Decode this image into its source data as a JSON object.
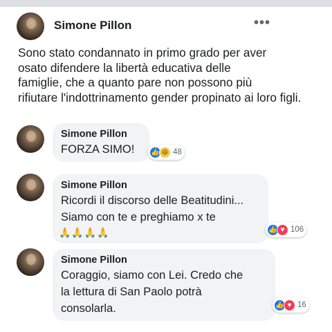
{
  "post": {
    "author": "Simone Pillon",
    "more_glyph": "•••",
    "text_lines": [
      "Sono stato condannato in primo grado per aver",
      "osato difendere la libertà educativa delle",
      "famiglie, che a quanto pare non possono più",
      "rifiutare l'indottrinamento gender propinato ai loro figli."
    ]
  },
  "comments": [
    {
      "author": "Simone Pillon",
      "lines": [
        "FORZA SIMO!"
      ],
      "reactions": [
        "like",
        "haha"
      ],
      "count": "48"
    },
    {
      "author": "Simone Pillon",
      "lines": [
        "Ricordi il discorso delle Beatitudini...",
        "Siamo con te e preghiamo x te"
      ],
      "emoji": "🙏🙏🙏🙏",
      "reactions": [
        "like",
        "love"
      ],
      "count": "106"
    },
    {
      "author": "Simone Pillon",
      "lines": [
        "Coraggio, siamo con Lei. Credo che",
        "la lettura di San Paolo potrà",
        "consolarla."
      ],
      "reactions": [
        "like",
        "love"
      ],
      "count": "16"
    }
  ],
  "icons": {
    "like": "thumbs-up-icon",
    "love": "heart-icon",
    "haha": "laughing-face-icon"
  },
  "colors": {
    "like": "#1877f2",
    "love": "#f33e58",
    "haha": "#f7c948",
    "bubble": "#f2f3f5"
  }
}
